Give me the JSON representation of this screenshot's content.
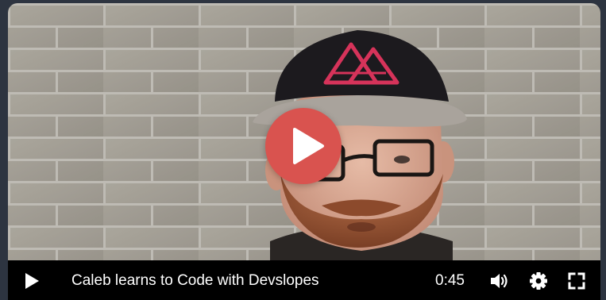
{
  "video": {
    "title": "Caleb learns to Code with Devslopes",
    "duration": "0:45"
  },
  "controls": {
    "play_icon": "play-icon",
    "volume_icon": "volume-icon",
    "settings_icon": "gear-icon",
    "fullscreen_icon": "fullscreen-icon"
  },
  "colors": {
    "accent": "#d9534f",
    "page_background": "#2d3440",
    "control_bar": "#000000",
    "cap_logo": "#d6335a"
  }
}
